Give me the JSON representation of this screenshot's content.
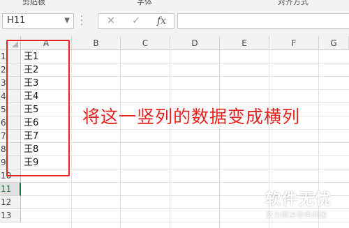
{
  "ribbon": {
    "labels": [
      "剪贴板",
      "字体",
      "对齐方式"
    ]
  },
  "formula_bar": {
    "name_box": "H11",
    "cancel_icon": "✕",
    "enter_icon": "✓",
    "fx_label": "fx",
    "formula_value": ""
  },
  "sheet": {
    "columns": [
      "A",
      "B",
      "C",
      "D",
      "E",
      "F",
      "G"
    ],
    "rows": [
      "1",
      "2",
      "3",
      "4",
      "5",
      "6",
      "7",
      "8",
      "9",
      "10",
      "11",
      "12",
      "13"
    ],
    "active_row": "11",
    "column_a_values": [
      "王1",
      "王2",
      "王3",
      "王4",
      "王5",
      "王6",
      "王7",
      "王8",
      "王9"
    ]
  },
  "annotation": {
    "text": "将这一竖列的数据变成横列",
    "color": "#e8231f"
  },
  "watermark": {
    "title": "软件无忧",
    "subtitle": "努力解决软件问题"
  },
  "colors": {
    "excel_green": "#217346",
    "highlight_red": "#e8231f"
  }
}
